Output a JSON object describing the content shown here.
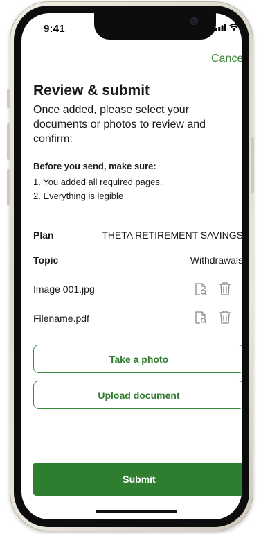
{
  "status": {
    "time": "9:41"
  },
  "header": {
    "cancel_label": "Cancel"
  },
  "page": {
    "title": "Review & submit",
    "intro": "Once added, please select your documents or photos to review and confirm:"
  },
  "checklist": {
    "title": "Before you send, make sure:",
    "items": [
      "1. You added all required pages.",
      "2. Everything is legible"
    ]
  },
  "details": [
    {
      "label": "Plan",
      "value": "THETA RETIREMENT SAVINGS"
    },
    {
      "label": "Topic",
      "value": "Withdrawals"
    }
  ],
  "files": [
    {
      "name": "Image 001.jpg",
      "icons": [
        "preview-icon",
        "trash-icon"
      ]
    },
    {
      "name": "Filename.pdf",
      "icons": [
        "preview-icon",
        "trash-icon"
      ]
    }
  ],
  "actions": {
    "take_photo_label": "Take a photo",
    "upload_label": "Upload document",
    "submit_label": "Submit"
  },
  "colors": {
    "accent": "#2f7d2e",
    "link": "#3b8a3a",
    "icon": "#8a8a8a"
  }
}
